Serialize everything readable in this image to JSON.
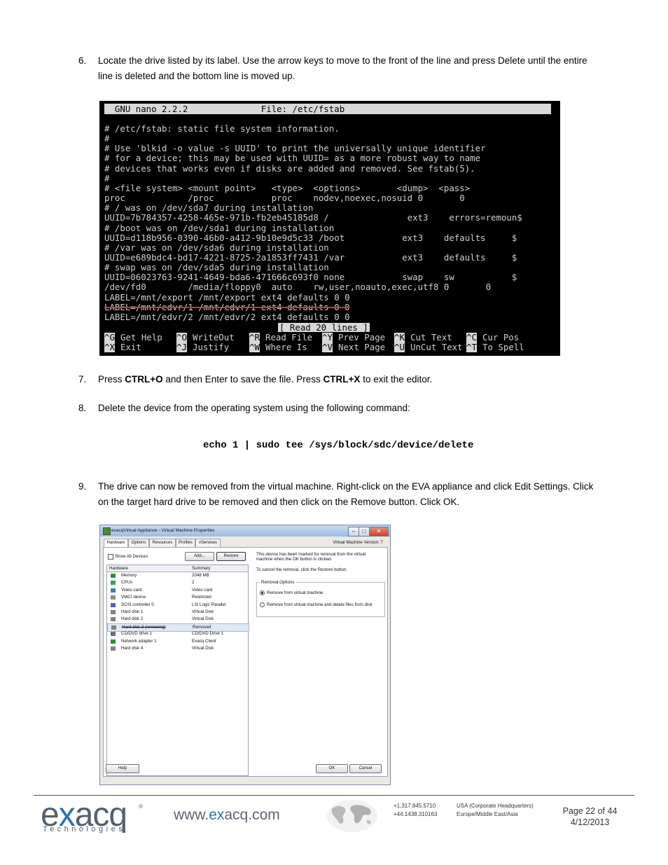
{
  "steps": [
    {
      "num": "6.",
      "line1": "Locate the drive listed by its label. Use the arrow keys to move to the front of the line and press Delete until the entire",
      "line2": "line is deleted and the bottom line is moved up."
    },
    {
      "num": "7.",
      "pre1": "Press ",
      "b1": "CTRL+O",
      "mid": " and then Enter to save the file. Press ",
      "b2": "CTRL+X",
      "post": " to exit the editor."
    },
    {
      "num": "8.",
      "text": "Delete the device from the operating system using the following command:"
    },
    {
      "num": "9.",
      "line1": "The drive can now be removed from the virtual machine. Right-click on the EVA appliance and click Edit Settings. Click",
      "line2": "on the target hard drive to be removed and then click on the Remove button. Click OK."
    }
  ],
  "command": "echo 1 | sudo tee /sys/block/sdc/device/delete",
  "terminal": {
    "title": "  GNU nano 2.2.2              File: /etc/fstab",
    "lines": [
      "# /etc/fstab: static file system information.",
      "#",
      "# Use 'blkid -o value -s UUID' to print the universally unique identifier",
      "# for a device; this may be used with UUID= as a more robust way to name",
      "# devices that works even if disks are added and removed. See fstab(5).",
      "#",
      "# <file system> <mount point>   <type>  <options>       <dump>  <pass>",
      "proc            /proc           proc    nodev,noexec,nosuid 0       0",
      "# / was on /dev/sda7 during installation",
      "UUID=7b784357-4258-465e-971b-fb2eb45185d8 /               ext3    errors=remoun$",
      "# /boot was on /dev/sda1 during installation",
      "UUID=d118b956-0390-46b0-a412-9b10e9d5c33 /boot           ext3    defaults     $",
      "# /var was on /dev/sda6 during installation",
      "UUID=e689bdc4-bd17-4221-8725-2a1853ff7431 /var           ext3    defaults     $",
      "# swap was on /dev/sda5 during installation",
      "UUID=06023763-9241-4649-bda6-471666c693f0 none           swap    sw           $",
      "/dev/fd0        /media/floppy0  auto    rw,user,noauto,exec,utf8 0       0",
      "LABEL=/mnt/export /mnt/export ext4 defaults 0 0"
    ],
    "deleted_line": "LABEL=/mnt/edvr/1 /mnt/edvr/1 ext4 defaults 0 0",
    "last_line": "LABEL=/mnt/edvr/2 /mnt/edvr/2 ext4 defaults 0 0",
    "status": "[ Read 20 lines ]",
    "shortcuts_row1": [
      [
        "^G",
        "Get Help"
      ],
      [
        "^O",
        "WriteOut"
      ],
      [
        "^R",
        "Read File"
      ],
      [
        "^Y",
        "Prev Page"
      ],
      [
        "^K",
        "Cut Text"
      ],
      [
        "^C",
        "Cur Pos"
      ]
    ],
    "shortcuts_row2": [
      [
        "^X",
        "Exit"
      ],
      [
        "^J",
        "Justify"
      ],
      [
        "^W",
        "Where Is"
      ],
      [
        "^V",
        "Next Page"
      ],
      [
        "^U",
        "UnCut Text"
      ],
      [
        "^T",
        "To Spell"
      ]
    ]
  },
  "dialog": {
    "title": "exacqVirtual Appliance - Virtual Machine Properties",
    "tabs": [
      "Hardware",
      "Options",
      "Resources",
      "Profiles",
      "vServices"
    ],
    "vm_version": "Virtual Machine Version: 7",
    "show_all": "Show All Devices",
    "add": "Add...",
    "restore": "Restore",
    "col_hardware": "Hardware",
    "col_summary": "Summary",
    "rows": [
      {
        "name": "Memory",
        "summary": "2048 MB",
        "color": "#3a8a3a"
      },
      {
        "name": "CPUs",
        "summary": "2",
        "color": "#3a9a5a"
      },
      {
        "name": "Video card",
        "summary": "Video card",
        "color": "#4a7ab8"
      },
      {
        "name": "VMCI device",
        "summary": "Restricted",
        "color": "#8a8a8a"
      },
      {
        "name": "SCSI controller 0",
        "summary": "LSI Logic Parallel",
        "color": "#5a5ab0"
      },
      {
        "name": "Hard disk 1",
        "summary": "Virtual Disk",
        "color": "#808080"
      },
      {
        "name": "Hard disk 2",
        "summary": "Virtual Disk",
        "color": "#808080"
      },
      {
        "name": "Hard disk 3 (removing)",
        "summary": "Removed",
        "color": "#808080"
      },
      {
        "name": "CD/DVD drive 1",
        "summary": "CD/DVD Drive 1",
        "color": "#6a6a8a"
      },
      {
        "name": "Network adapter 1",
        "summary": "Exacq Client",
        "color": "#3a8a3a"
      },
      {
        "name": "Hard disk 4",
        "summary": "Virtual Disk",
        "color": "#808080"
      }
    ],
    "note1": "This device has been marked for removal from the virtual machine when the OK button is clicked.",
    "note2": "To cancel the removal, click the Restore button.",
    "removal_options": "Removal Options",
    "opt1": "Remove from virtual machine",
    "opt2": "Remove from virtual machine and delete files from disk",
    "help": "Help",
    "ok": "OK",
    "cancel": "Cancel"
  },
  "footer": {
    "logo_pre": "e",
    "logo_x": "x",
    "logo_post": "acq",
    "logo_reg": "®",
    "logo_sub": "Technologies",
    "url_pre": "www.",
    "url_ex": "ex",
    "url_post": "acq.com",
    "phone1": "+1.317.845.5710",
    "phone2": "+44.1438.310163",
    "region1": "USA (Corporate Headquarters)",
    "region2": "Europe/Middle East/Asia",
    "page": "Page 22 of 44",
    "date": "4/12/2013"
  }
}
